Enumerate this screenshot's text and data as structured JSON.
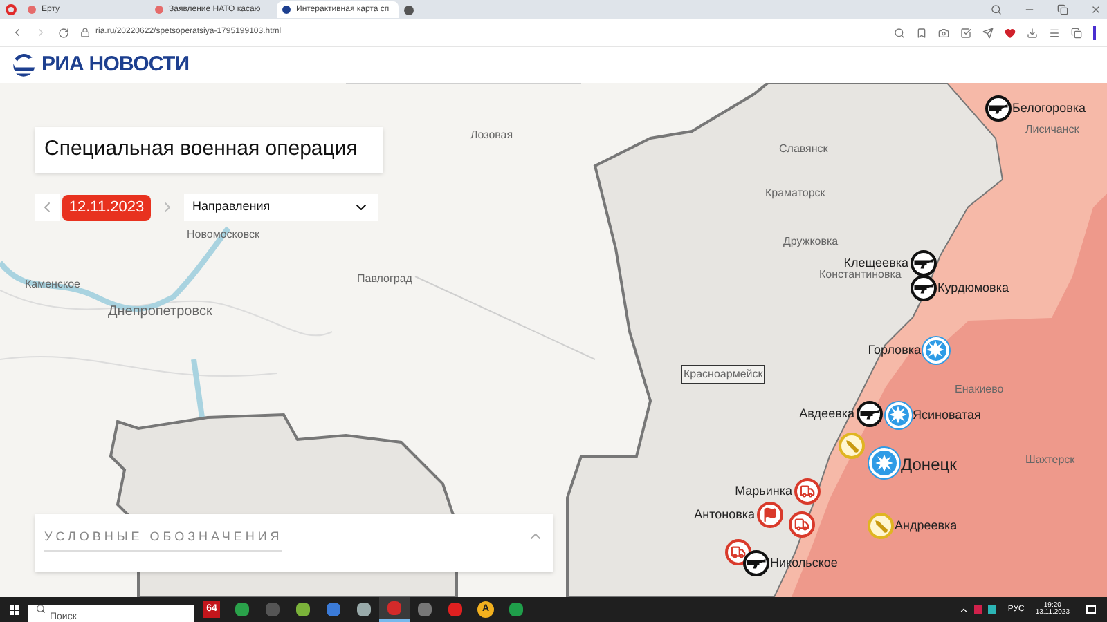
{
  "browser": {
    "tabs": [
      {
        "title": "Ерту",
        "selected": false
      },
      {
        "title": "Заявление НАТО касаю",
        "selected": false
      },
      {
        "title": "Интерактивная карта сп",
        "selected": true
      }
    ],
    "url": "ria.ru/20220622/spetsoperatsiya-1795199103.html"
  },
  "site": {
    "logo": "РИА НОВОСТИ"
  },
  "map": {
    "title": "Специальная военная операция",
    "date": "12.11.2023",
    "directions": {
      "value": "Направления"
    },
    "cities": [
      {
        "name": "Лозовая"
      },
      {
        "name": "Новомосковск"
      },
      {
        "name": "Каменское"
      },
      {
        "name": "Днепропетровск"
      },
      {
        "name": "Павлоград"
      },
      {
        "name": "Славянск"
      },
      {
        "name": "Краматорск"
      },
      {
        "name": "Дружковка"
      },
      {
        "name": "Константиновка"
      },
      {
        "name": "Енакиево"
      },
      {
        "name": "Шахтерск"
      },
      {
        "name": "Лисичанск"
      },
      {
        "name": "Красноармейск"
      }
    ],
    "markers": [
      {
        "kind": "gun",
        "label": "Белогоровка"
      },
      {
        "kind": "gun",
        "label": "Клещеевка"
      },
      {
        "kind": "gun",
        "label": "Курдюмовка"
      },
      {
        "kind": "blast",
        "label": "Горловка"
      },
      {
        "kind": "gun",
        "label": "Авдеевка"
      },
      {
        "kind": "blast",
        "label": "Ясиноватая"
      },
      {
        "kind": "blast",
        "label": "Донецк"
      },
      {
        "kind": "rocket"
      },
      {
        "kind": "truck",
        "label": "Марьинка"
      },
      {
        "kind": "flag",
        "label": "Антоновка"
      },
      {
        "kind": "truck"
      },
      {
        "kind": "rocket",
        "label": "Андреевка"
      },
      {
        "kind": "truck"
      },
      {
        "kind": "gun",
        "label": "Никольское"
      }
    ],
    "legend": {
      "title": "УСЛОВНЫЕ ОБОЗНАЧЕНИЯ"
    }
  },
  "taskbar": {
    "search": {
      "placeholder": "Поиск"
    },
    "apps": [
      {
        "kind": "text",
        "text": "64",
        "selected": false
      },
      {
        "kind": "tile",
        "selected": false
      },
      {
        "kind": "tile",
        "selected": false
      },
      {
        "kind": "tile",
        "selected": false
      },
      {
        "kind": "tile",
        "selected": false
      },
      {
        "kind": "tile",
        "selected": false
      },
      {
        "kind": "tile",
        "selected": true
      },
      {
        "kind": "tile",
        "selected": false
      },
      {
        "kind": "tile",
        "selected": false
      },
      {
        "kind": "text",
        "text": "A",
        "selected": false
      },
      {
        "kind": "tile",
        "selected": false
      }
    ],
    "language": "РУС",
    "time": "19:20",
    "date": "13.11.2023"
  }
}
